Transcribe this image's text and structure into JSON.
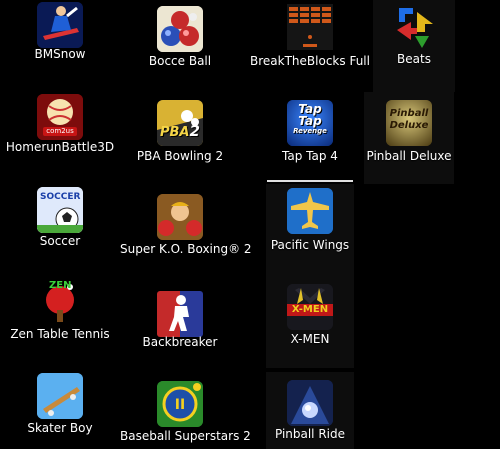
{
  "apps": [
    {
      "label": "BMSnow",
      "icon": "snowboarder-icon"
    },
    {
      "label": "Bocce Ball",
      "icon": "bocce-balls-icon"
    },
    {
      "label": "BreakTheBlocks Full",
      "icon": "brick-breaker-icon"
    },
    {
      "label": "Beats",
      "icon": "colored-arrows-icon"
    },
    {
      "label": "HomerunBattle3D",
      "icon": "baseball-fire-icon"
    },
    {
      "label": "PBA Bowling 2",
      "icon": "bowling-pins-icon"
    },
    {
      "label": "Tap Tap 4",
      "icon": "tap-tap-revenge-icon"
    },
    {
      "label": "Pinball Deluxe",
      "icon": "pinball-deluxe-icon"
    },
    {
      "label": "Soccer",
      "icon": "soccer-ball-icon"
    },
    {
      "label": "Super K.O. Boxing® 2",
      "icon": "boxer-icon"
    },
    {
      "label": "Pacific Wings",
      "icon": "airplane-icon"
    },
    {
      "label": "Zen Table Tennis",
      "icon": "ping-pong-paddle-icon"
    },
    {
      "label": "Backbreaker",
      "icon": "football-player-icon"
    },
    {
      "label": "X-MEN",
      "icon": "xmen-icon"
    },
    {
      "label": "Skater Boy",
      "icon": "skateboard-icon"
    },
    {
      "label": "Baseball Superstars 2",
      "icon": "baseball-superstars-icon"
    },
    {
      "label": "Pinball Ride",
      "icon": "pinball-ride-icon"
    }
  ],
  "icon_text": {
    "homerun_badge": "com2us",
    "pba_badge": "PBA",
    "pba_num": "2",
    "taptap_line1": "Tap",
    "taptap_line2": "Tap",
    "taptap_line3": "Revenge",
    "pinball_line1": "Pinball",
    "pinball_line2": "Deluxe",
    "soccer_badge": "SOCCER",
    "zen_badge": "ZEN",
    "xmen_badge": "X-MEN"
  }
}
